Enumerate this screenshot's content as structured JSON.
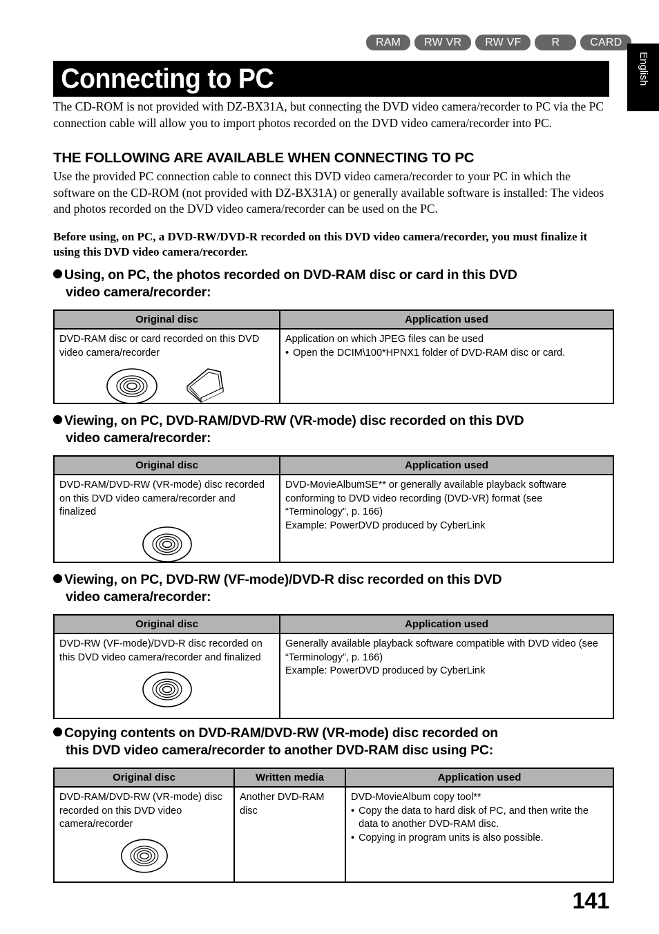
{
  "media_badges": [
    "RAM",
    "RW VR",
    "RW VF",
    "R",
    "CARD"
  ],
  "side_tab": "English",
  "title": "Connecting to PC",
  "intro": "The CD-ROM is not provided with DZ-BX31A, but connecting the DVD video camera/recorder to PC via the PC connection cable will allow you to import photos recorded on the DVD video camera/recorder into PC.",
  "heading2": "THE FOLLOWING ARE AVAILABLE WHEN CONNECTING TO PC",
  "paragraph2": "Use the provided PC connection cable to connect this DVD video camera/recorder to your PC in which the software on the CD-ROM (not provided with DZ-BX31A) or generally available software is installed: The videos and photos recorded on the DVD video camera/recorder can be used on the PC.",
  "paragraph_bold": "Before using, on PC, a DVD-RW/DVD-R recorded on this DVD video camera/recorder, you must finalize it using this DVD video camera/recorder.",
  "sections": [
    {
      "heading_line1": "Using, on PC, the photos recorded on DVD-RAM disc or card in this DVD",
      "heading_line2": "video camera/recorder:",
      "headers": [
        "Original disc",
        "Application used"
      ],
      "col1_text": "DVD-RAM disc or card recorded on this DVD video camera/recorder",
      "col2_line1": "Application on which JPEG files can be used",
      "col2_bullets": [
        "Open the DCIM\\100*HPNX1 folder of DVD-RAM disc or card."
      ]
    },
    {
      "heading_line1": "Viewing, on PC, DVD-RAM/DVD-RW (VR-mode) disc recorded on this DVD",
      "heading_line2": "video camera/recorder:",
      "headers": [
        "Original disc",
        "Application used"
      ],
      "col1_text": "DVD-RAM/DVD-RW (VR-mode) disc recorded on this DVD video camera/recorder and finalized",
      "col2_lines": [
        "DVD-MovieAlbumSE** or generally available playback software conforming to DVD video recording (DVD-VR) format (see “Terminology”, p. 166)",
        "Example: PowerDVD produced by CyberLink"
      ]
    },
    {
      "heading_line1": "Viewing, on PC, DVD-RW (VF-mode)/DVD-R disc recorded on this DVD",
      "heading_line2": "video camera/recorder:",
      "headers": [
        "Original disc",
        "Application used"
      ],
      "col1_text": "DVD-RW (VF-mode)/DVD-R disc recorded on this DVD video camera/recorder and finalized",
      "col2_lines": [
        "Generally available playback software compatible with DVD video (see “Terminology”, p. 166)",
        "Example: PowerDVD produced by CyberLink"
      ]
    },
    {
      "heading_line1": "Copying contents on DVD-RAM/DVD-RW (VR-mode) disc recorded on",
      "heading_line2": "this DVD video camera/recorder to another DVD-RAM disc using PC:",
      "headers": [
        "Original disc",
        "Written media",
        "Application used"
      ],
      "col1_text": "DVD-RAM/DVD-RW (VR-mode) disc recorded on this DVD video camera/recorder",
      "col2_text": "Another DVD-RAM disc",
      "col3_line1": "DVD-MovieAlbum copy tool**",
      "col3_bullets": [
        "Copy the data to hard disk of PC, and then write the data to another DVD-RAM disc.",
        "Copying in program units is also possible."
      ]
    }
  ],
  "page_number": "141",
  "colors": {
    "badge_gray": "#666666",
    "table_header_gray": "#b3b3b3",
    "banner_black": "#000000"
  }
}
